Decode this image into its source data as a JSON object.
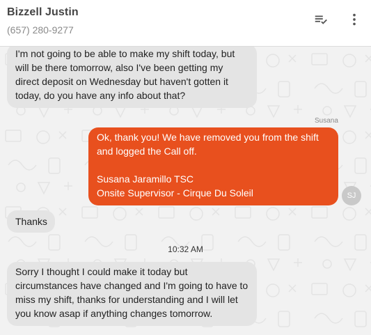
{
  "header": {
    "contact_name": "Bizzell Justin",
    "contact_phone": "(657) 280-9277",
    "mark_read_icon": "playlist-check-icon",
    "more_icon": "more-vert-icon"
  },
  "thread": {
    "messages": [
      {
        "direction": "incoming",
        "text": "I'm not going to be able to make my shift today, but\nwill be there tomorrow, also I've been getting my\ndirect deposit on Wednesday but haven't gotten it\ntoday, do you have any info about that?"
      },
      {
        "direction": "outgoing",
        "sender": "Susana",
        "avatar_initials": "SJ",
        "text": "Ok, thank you! We have removed you from the shift\nand logged the Call off.\n\nSusana Jaramillo TSC\nOnsite Supervisor - Cirque Du Soleil"
      },
      {
        "direction": "incoming",
        "text": "Thanks"
      },
      {
        "direction": "incoming",
        "text": "Sorry I thought I could make it today but\ncircumstances have changed and I'm going to have to\nmiss my shift, thanks for understanding and I will let\nyou know asap if anything changes tomorrow."
      }
    ],
    "timestamp": "10:32 AM"
  },
  "colors": {
    "outgoing_bubble": "#e8501e",
    "incoming_bubble": "#e4e4e4",
    "header_bg": "#ffffff",
    "thread_bg": "#f2f2f2"
  }
}
